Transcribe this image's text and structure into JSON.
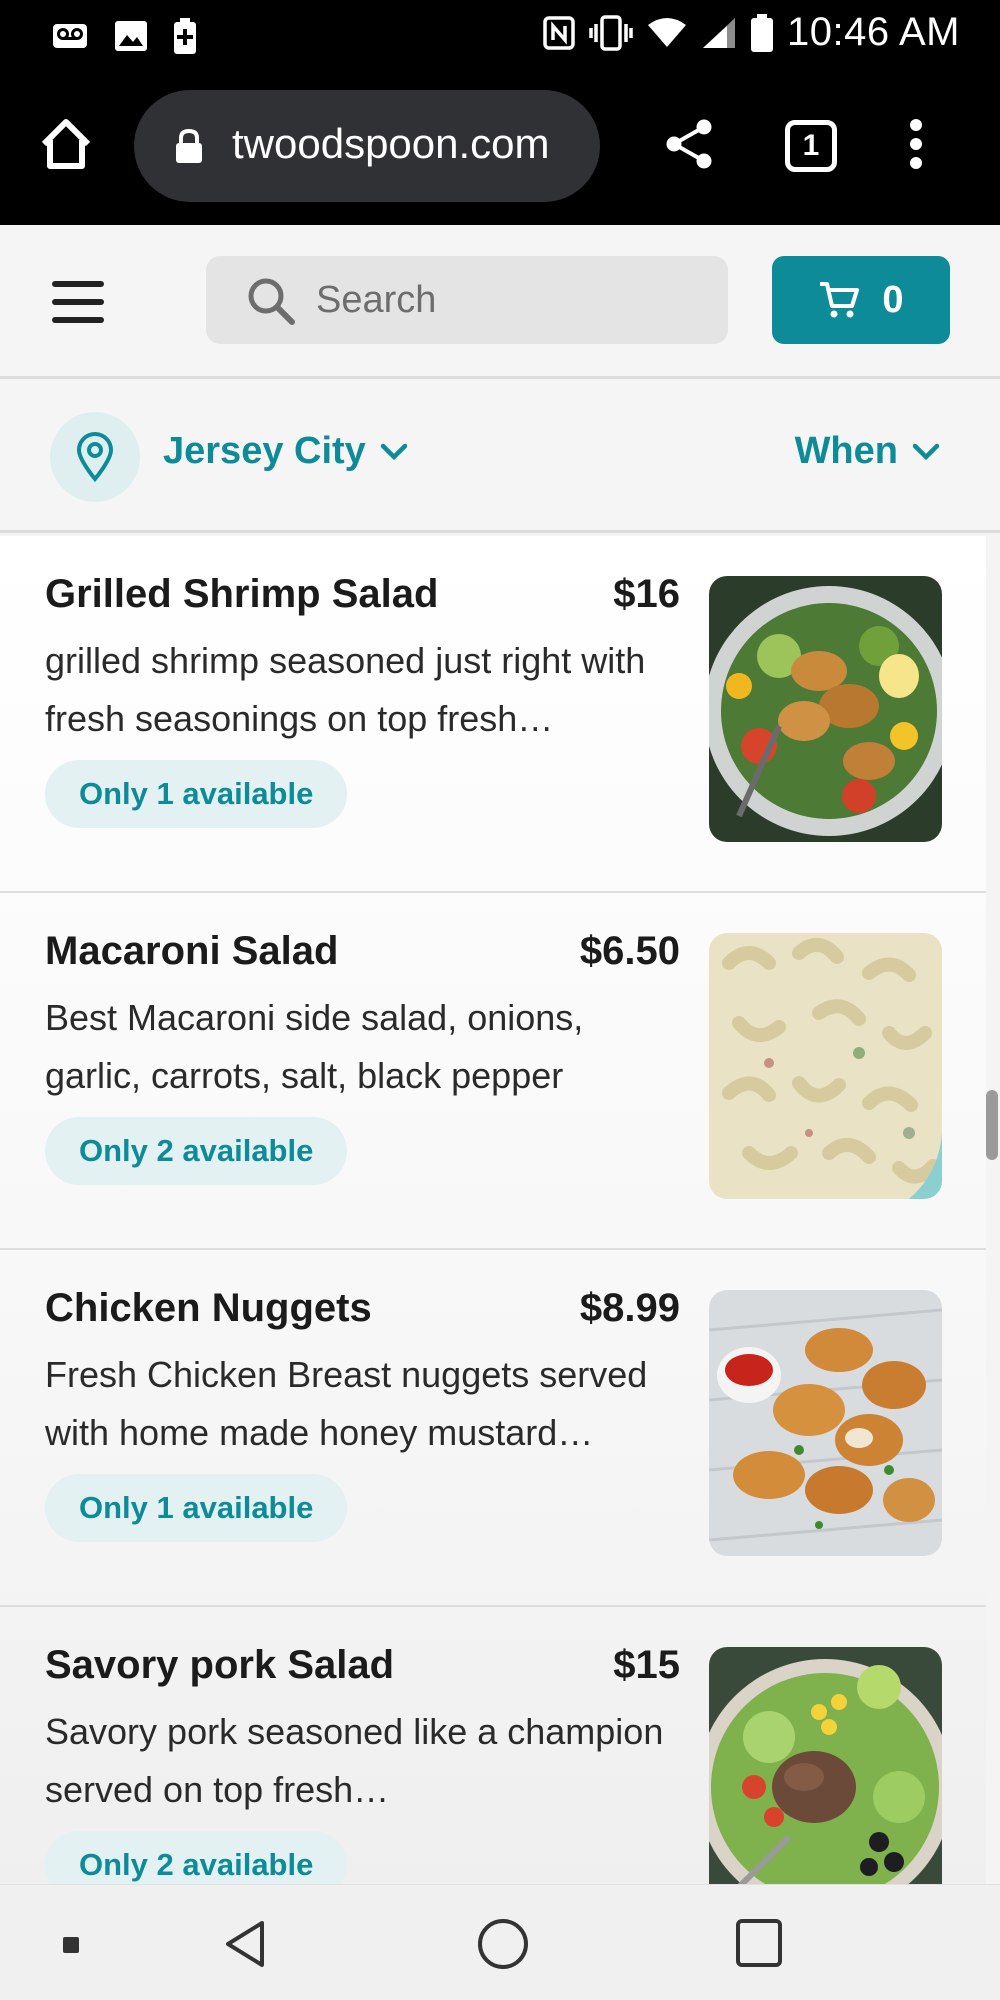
{
  "status_bar": {
    "time": "10:46 AM",
    "icons": [
      "voicemail-icon",
      "image-icon",
      "battery-saver-icon",
      "nfc-icon",
      "vibrate-icon",
      "wifi-icon",
      "signal-icon",
      "battery-icon"
    ]
  },
  "browser": {
    "url": "twoodspoon.com",
    "tab_count": "1",
    "icons": [
      "home-icon",
      "lock-icon",
      "share-icon",
      "more-vert-icon"
    ]
  },
  "header": {
    "search_placeholder": "Search",
    "cart_count": "0"
  },
  "location": {
    "city": "Jersey City",
    "when": "When"
  },
  "menu_items": [
    {
      "name": "Grilled Shrimp Salad",
      "price": "$16",
      "description": "grilled shrimp seasoned just right with fresh seasonings on top fresh…",
      "availability": "Only 1 available",
      "image": "grilled-shrimp-salad-photo"
    },
    {
      "name": "Macaroni Salad",
      "price": "$6.50",
      "description": "Best Macaroni side salad, onions, garlic, carrots, salt, black pepper",
      "availability": "Only 2 available",
      "image": "macaroni-salad-photo"
    },
    {
      "name": "Chicken Nuggets",
      "price": "$8.99",
      "description": "Fresh Chicken Breast nuggets served with home made honey mustard…",
      "availability": "Only 1 available",
      "image": "chicken-nuggets-photo"
    },
    {
      "name": "Savory pork Salad",
      "price": "$15",
      "description": "Savory pork seasoned like a champion served on top fresh…",
      "availability": "Only 2 available",
      "image": "savory-pork-salad-photo"
    }
  ],
  "colors": {
    "accent": "#0e8b98",
    "badge_bg": "#e3f1f2",
    "status_bar_bg": "#000000"
  }
}
